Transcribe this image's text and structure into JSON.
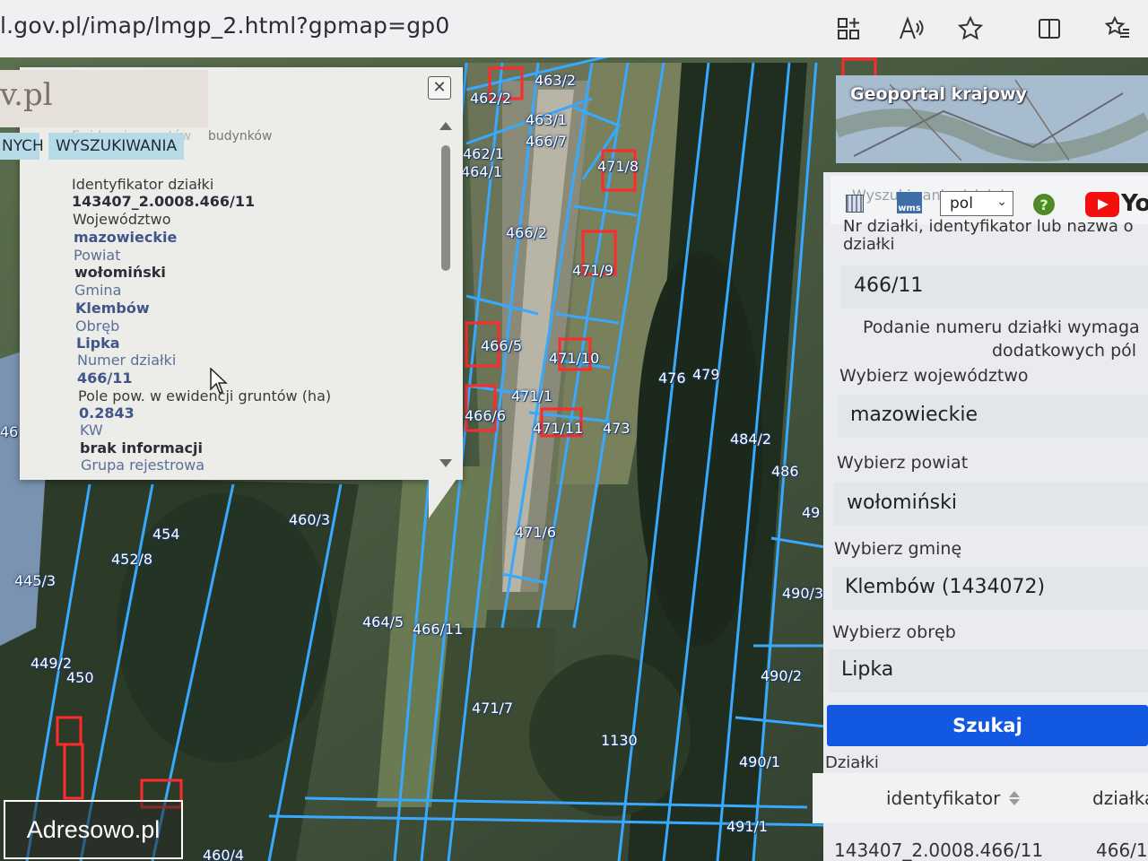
{
  "browser": {
    "url": "l.gov.pl/imap/lmgp_2.html?gpmap=gp0",
    "icons": [
      "apps-icon",
      "read-aloud-icon",
      "favorite-star-icon",
      "split-screen-icon",
      "favorites-list-icon"
    ]
  },
  "popup": {
    "logo_fragment": "v.pl",
    "tabs": [
      "NYCH",
      "WYSZUKIWANIA"
    ],
    "faded_tab_text": "Ewidencja gruntów",
    "faded_tab_text2": "budynków",
    "attributes": [
      {
        "label": "Identyfikator działki",
        "value": "143407_2.0008.466/11"
      },
      {
        "label": "Województwo",
        "value": "mazowieckie"
      },
      {
        "label": "Powiat",
        "value": "wołomiński"
      },
      {
        "label": "Gmina",
        "value": "Klembów"
      },
      {
        "label": "Obręb",
        "value": "Lipka"
      },
      {
        "label": "Numer działki",
        "value": "466/11"
      },
      {
        "label": "Pole pow. w ewidencji gruntów (ha)",
        "value": "0.2843"
      },
      {
        "label": "KW",
        "value": "brak informacji"
      },
      {
        "label": "Grupa rejestrowa",
        "value": ""
      }
    ]
  },
  "map": {
    "plot_labels": [
      "463/2",
      "462/2",
      "463/1",
      "466/7",
      "462/1",
      "464/1",
      "471/8",
      "466/2",
      "471/9",
      "466/5",
      "471/10",
      "476",
      "479",
      "471/1",
      "466/6",
      "471/11",
      "473",
      "484/2",
      "486",
      "460/3",
      "454",
      "452/8",
      "471/6",
      "445/3",
      "464/5",
      "466/11",
      "449/2",
      "450",
      "471/7",
      "1130",
      "490/3",
      "490/2",
      "490/1",
      "491/1",
      "460/4",
      "46",
      "49"
    ]
  },
  "right_panel": {
    "geoportal_title": "Geoportal krajowy",
    "faded_header": "Wyszukiwanie działek",
    "language": "pol",
    "youtube_text": "You",
    "search_hint": "Nr działki, identyfikator lub nazwa o",
    "search_hint_2": "działki",
    "search_value": "466/11",
    "notice_line1": "Podanie numeru działki wymaga",
    "notice_line2": "dodatkowych pól",
    "voivodeship_label": "Wybierz województwo",
    "voivodeship_value": "mazowieckie",
    "county_label": "Wybierz powiat",
    "county_value": "wołomiński",
    "commune_label": "Wybierz gminę",
    "commune_value": "Klembów (1434072)",
    "precinct_label": "Wybierz obręb",
    "precinct_value": "Lipka",
    "search_button": "Szukaj",
    "results_title": "Działki",
    "results_col_id": "identyfikator",
    "results_col_plot": "działka",
    "results_row_id": "143407_2.0008.466/11",
    "results_row_plot": "466/1"
  },
  "watermark": "Adresowo.pl"
}
